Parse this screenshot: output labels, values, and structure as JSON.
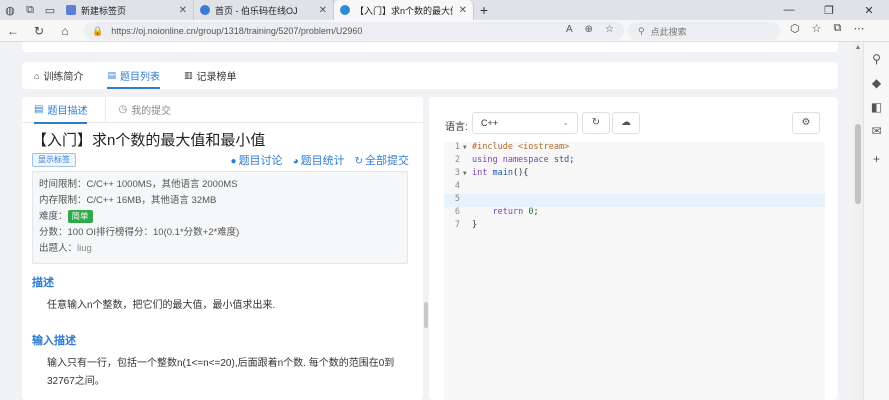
{
  "browser": {
    "tabs": [
      {
        "title": "新建标签页",
        "favicon_color": "#5a7fd4",
        "active": false
      },
      {
        "title": "首页 - 伯乐码在线OJ",
        "favicon_color": "#3b7bd6",
        "active": false
      },
      {
        "title": "【入门】求n个数的最大值和最小值",
        "favicon_color": "#2f8bd6",
        "active": true
      }
    ],
    "url": "https://oj.noionline.cn/group/1318/training/5207/problem/U2960",
    "search_placeholder": "点此搜索"
  },
  "page": {
    "topnav": [
      {
        "label": "训练简介",
        "icon": "home-icon",
        "active": false
      },
      {
        "label": "题目列表",
        "icon": "list-icon",
        "active": true
      },
      {
        "label": "记录榜单",
        "icon": "bar-chart-icon",
        "active": false
      }
    ],
    "subtabs": [
      {
        "label": "题目描述",
        "active": true
      },
      {
        "label": "我的提交",
        "active": false
      }
    ],
    "problem": {
      "title": "【入门】求n个数的最大值和最小值",
      "show_tags": "显示标签",
      "links": [
        "题目讨论",
        "题目统计",
        "全部提交"
      ],
      "meta": {
        "time_limit": "时间限制：C/C++ 1000MS，其他语言 2000MS",
        "memory_limit": "内存限制：C/C++ 16MB，其他语言 32MB",
        "difficulty_label": "难度：",
        "difficulty": "简单",
        "score": "分数：100  OI排行榜得分：10(0.1*分数+2*难度)",
        "author": "出题人：",
        "author_name": "liug"
      },
      "desc_title": "描述",
      "desc_text": "任意输入n个整数，把它们的最大值，最小值求出来.",
      "input_title": "输入描述",
      "input_text": "输入只有一行，包括一个整数n(1<=n<=20),后面跟着n个数. 每个数的范围在0到32767之间。"
    },
    "editor": {
      "lang_label": "语言:",
      "language": "C++",
      "line_numbers": [
        "1",
        "2",
        "3",
        "4",
        "5",
        "6",
        "7"
      ]
    }
  },
  "colors": {
    "accent": "#2f7bd3",
    "success": "#2faa4a"
  }
}
